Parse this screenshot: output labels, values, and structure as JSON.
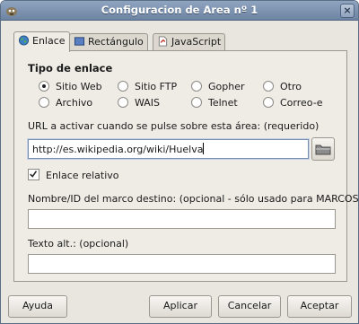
{
  "window": {
    "title": "Configuracion de Area nº 1"
  },
  "tabs": [
    {
      "label": "Enlace",
      "icon": "globe-icon",
      "active": true
    },
    {
      "label": "Rectángulo",
      "icon": "rectangle-icon",
      "active": false
    },
    {
      "label": "JavaScript",
      "icon": "javascript-icon",
      "active": false
    }
  ],
  "link_type": {
    "title": "Tipo de enlace",
    "options": [
      {
        "label": "Sitio Web",
        "checked": true
      },
      {
        "label": "Sitio FTP",
        "checked": false
      },
      {
        "label": "Gopher",
        "checked": false
      },
      {
        "label": "Otro",
        "checked": false
      },
      {
        "label": "Archivo",
        "checked": false
      },
      {
        "label": "WAIS",
        "checked": false
      },
      {
        "label": "Telnet",
        "checked": false
      },
      {
        "label": "Correo-e",
        "checked": false
      }
    ]
  },
  "url": {
    "label": "URL a activar cuando se pulse sobre esta área: (requerido)",
    "value": "http://es.wikipedia.org/wiki/Huelva"
  },
  "relative": {
    "label": "Enlace relativo",
    "checked": true
  },
  "frame": {
    "label": "Nombre/ID del marco destino: (opcional - sólo usado para MARCOS)",
    "value": ""
  },
  "alt": {
    "label": "Texto alt.: (opcional)",
    "value": ""
  },
  "buttons": {
    "help": "Ayuda",
    "apply": "Aplicar",
    "cancel": "Cancelar",
    "accept": "Aceptar"
  },
  "colors": {
    "titlebar": "#7a8fad",
    "window_bg": "#e9e6df",
    "focus": "#7a8fb0"
  }
}
